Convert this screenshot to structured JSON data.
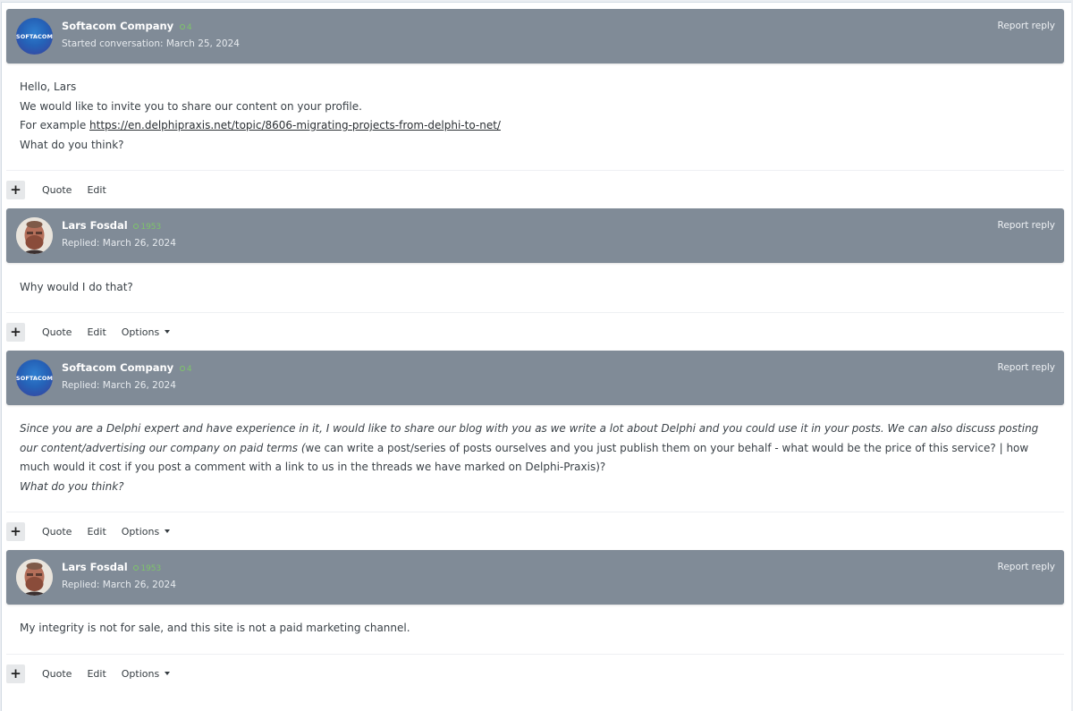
{
  "thread": {
    "report_label": "Report reply",
    "quote_label": "Quote",
    "edit_label": "Edit",
    "options_label": "Options",
    "plus_label": "+",
    "posts": [
      {
        "avatar_text": "SOFTACOM",
        "author": "Softacom Company",
        "reputation": "4",
        "date": "Started conversation: March 25, 2024",
        "body": {
          "line1": "Hello, Lars",
          "line2": "We would like to invite you to share our content on your profile.",
          "line3_prefix": "For example ",
          "link": "https://en.delphipraxis.net/topic/8606-migrating-projects-from-delphi-to-net/",
          "line4": "What do you think?"
        }
      },
      {
        "author": "Lars Fosdal",
        "reputation": "1953",
        "date": "Replied: March 26, 2024",
        "body": {
          "line1": "Why would I do that?"
        }
      },
      {
        "avatar_text": "SOFTACOM",
        "author": "Softacom Company",
        "reputation": "4",
        "date": "Replied: March 26, 2024",
        "body": {
          "italic1": "Since you are a Delphi expert and have experience in it, I would like to share our blog with you as we write a lot about Delphi and you could use it in your posts. We can also discuss posting our content/advertising our company on paid terms (",
          "normal1": "we can write a post/series of posts ourselves and you just publish them on your behalf - what would be the price of this service? | how much would it cost if you post a comment with a link to us in the threads we have marked on Delphi-Praxis)?",
          "italic2": "What do you think?"
        }
      },
      {
        "author": "Lars Fosdal",
        "reputation": "1953",
        "date": "Replied: March 26, 2024",
        "body": {
          "line1": "My integrity is not for sale, and this site is not a paid marketing channel."
        }
      }
    ]
  }
}
